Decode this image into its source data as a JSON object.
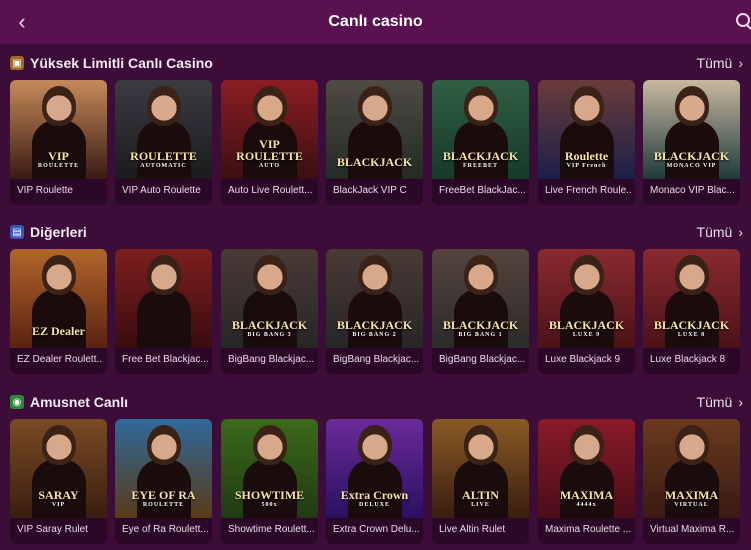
{
  "header": {
    "title": "Canlı casino",
    "back_icon": "chevron-left-icon",
    "search_icon": "search-icon"
  },
  "sections": [
    {
      "title": "Yüksek Limitli Canlı Casino",
      "icon": "treasure-box-icon",
      "see_all": "Tümü",
      "cards": [
        {
          "label": "VIP Roulette",
          "logo": "VIP",
          "logo_sub": "ROULETTE",
          "bg": "#3a1a14",
          "accent": "#c58a5a"
        },
        {
          "label": "VIP Auto Roulette",
          "logo": "ROULETTE",
          "logo_sub": "AUTOMATIC",
          "bg": "#1b1b1e",
          "accent": "#3b3b40"
        },
        {
          "label": "Auto Live Roulett...",
          "logo": "VIP ROULETTE",
          "logo_sub": "AUTO",
          "bg": "#3c0f12",
          "accent": "#8b1e22"
        },
        {
          "label": "BlackJack VIP C",
          "logo": "BLACKJACK",
          "logo_sub": "",
          "bg": "#242a26",
          "accent": "#4f4a44"
        },
        {
          "label": "FreeBet BlackJac...",
          "logo": "BLACKJACK",
          "logo_sub": "FREEBET",
          "bg": "#173a2a",
          "accent": "#2f5e43"
        },
        {
          "label": "Live French Roule...",
          "logo": "Roulette",
          "logo_sub": "VIP French",
          "bg": "#1c1f4a",
          "accent": "#6a3c3a"
        },
        {
          "label": "Monaco VIP Blac...",
          "logo": "BLACKJACK",
          "logo_sub": "MONACO VIP",
          "bg": "#1d3a3a",
          "accent": "#c9b8a0"
        }
      ]
    },
    {
      "title": "Diğerleri",
      "icon": "cards-icon",
      "see_all": "Tümü",
      "cards": [
        {
          "label": "EZ Dealer Roulett...",
          "logo": "EZ Dealer",
          "logo_sub": "",
          "bg": "#5a2210",
          "accent": "#b2662c"
        },
        {
          "label": "Free Bet Blackjac...",
          "logo": "",
          "logo_sub": "",
          "bg": "#3a0c10",
          "accent": "#7d1f1f"
        },
        {
          "label": "BigBang Blackjac...",
          "logo": "BLACKJACK",
          "logo_sub": "BIG BANG 3",
          "bg": "#262626",
          "accent": "#4a3a36"
        },
        {
          "label": "BigBang Blackjac...",
          "logo": "BLACKJACK",
          "logo_sub": "BIG BANG 2",
          "bg": "#262626",
          "accent": "#4a3a36"
        },
        {
          "label": "BigBang Blackjac...",
          "logo": "BLACKJACK",
          "logo_sub": "BIG BANG 1",
          "bg": "#2b2b2b",
          "accent": "#55433e"
        },
        {
          "label": "Luxe Blackjack 9",
          "logo": "BLACKJACK",
          "logo_sub": "LUXE 9",
          "bg": "#4a1218",
          "accent": "#8a2a30"
        },
        {
          "label": "Luxe Blackjack 8",
          "logo": "BLACKJACK",
          "logo_sub": "LUXE 8",
          "bg": "#4a1218",
          "accent": "#8a2a30"
        }
      ]
    },
    {
      "title": "Amusnet Canlı",
      "icon": "amusnet-icon",
      "see_all": "Tümü",
      "cards": [
        {
          "label": "VIP Saray Rulet",
          "logo": "SARAY",
          "logo_sub": "VIP",
          "bg": "#3a1e10",
          "accent": "#7a4a24"
        },
        {
          "label": "Eye of Ra Roulett...",
          "logo": "EYE OF RA",
          "logo_sub": "ROULETTE",
          "bg": "#5a3a18",
          "accent": "#2f6a9a"
        },
        {
          "label": "Showtime Roulett...",
          "logo": "SHOWTIME",
          "logo_sub": "500x",
          "bg": "#1f3a12",
          "accent": "#3c6a1a"
        },
        {
          "label": "Extra Crown Delu...",
          "logo": "Extra Crown",
          "logo_sub": "DELUXE",
          "bg": "#2a1060",
          "accent": "#6a2a9a"
        },
        {
          "label": "Live Altin Rulet",
          "logo": "ALTIN",
          "logo_sub": "LIVE",
          "bg": "#3a1e10",
          "accent": "#8a5a24"
        },
        {
          "label": "Maxima Roulette ...",
          "logo": "MAXIMA",
          "logo_sub": "4444x",
          "bg": "#4a0e18",
          "accent": "#8a1a2a"
        },
        {
          "label": "Virtual Maxima R...",
          "logo": "MAXIMA",
          "logo_sub": "VIRTUAL",
          "bg": "#3a1a12",
          "accent": "#6a3a1e"
        }
      ]
    }
  ]
}
